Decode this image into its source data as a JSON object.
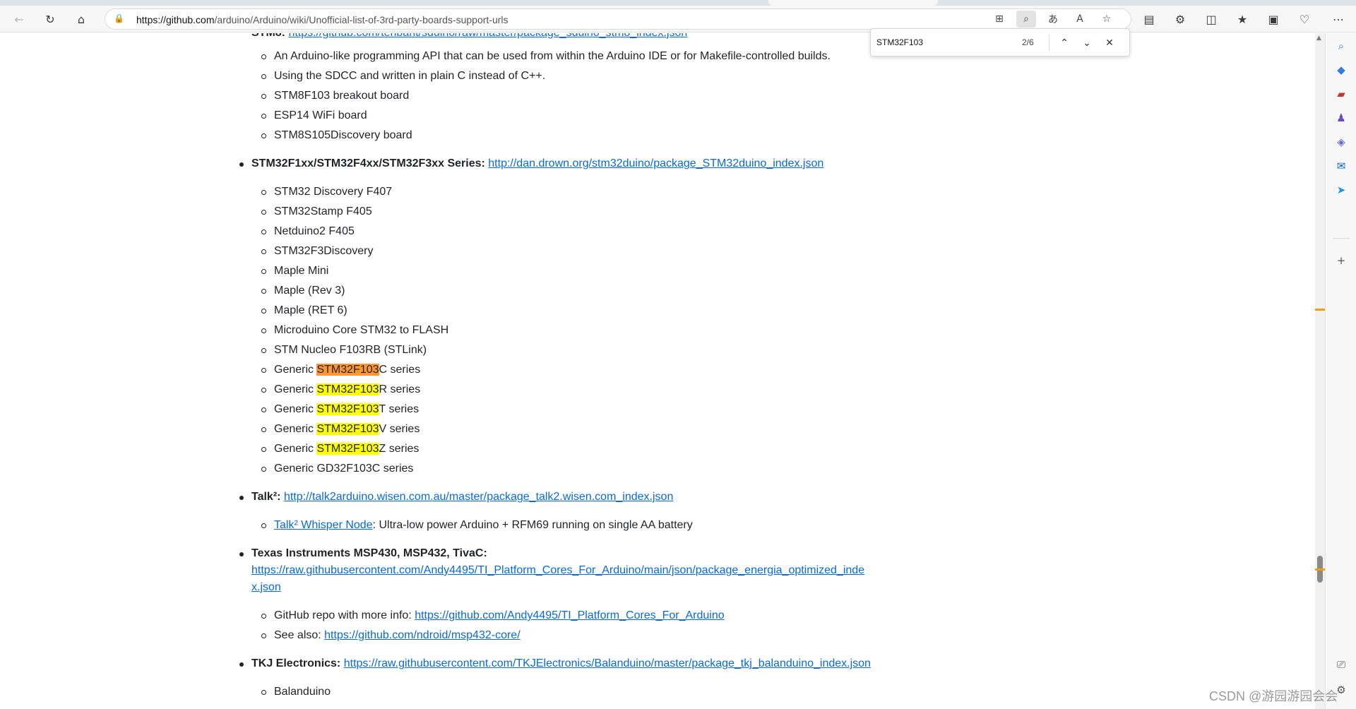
{
  "browser": {
    "url_host": "https://github.com",
    "url_path": "/arduino/Arduino/wiki/Unofficial-list-of-3rd-party-boards-support-urls",
    "toolbar": {
      "back_icon": "←",
      "refresh_icon": "↻",
      "home_icon": "⌂",
      "lock_icon": "🔒",
      "apps_icon": "⊞",
      "find_icon": "⌕",
      "translate_icon": "あ",
      "read_aloud_icon": "A",
      "favorite_icon": "☆",
      "tab_actions_icon": "▤",
      "extensions_icon": "⚙",
      "split_icon": "◫",
      "favorites_icon": "★",
      "collections_icon": "▣",
      "health_icon": "♡",
      "more_icon": "⋯"
    }
  },
  "findbar": {
    "query": "STM32F103",
    "count": "2/6",
    "prev_icon": "⌃",
    "next_icon": "⌄",
    "close_icon": "✕"
  },
  "content": {
    "partial_top_label": "STM8:",
    "partial_top_link": "https://github.com/tenbaht/sduino/raw/master/package_sduino_stm8_index.json",
    "stm8_items": [
      "An Arduino-like programming API that can be used from within the Arduino IDE or for Makefile-controlled builds.",
      "Using the SDCC and written in plain C instead of C++.",
      "STM8F103 breakout board",
      "ESP14 WiFi board",
      "STM8S105Discovery board"
    ],
    "stm32_label": "STM32F1xx/STM32F4xx/STM32F3xx Series:",
    "stm32_link": "http://dan.drown.org/stm32duino/package_STM32duino_index.json",
    "stm32_items": [
      "STM32 Discovery F407",
      "STM32Stamp F405",
      "Netduino2 F405",
      "STM32F3Discovery",
      "Maple Mini",
      "Maple (Rev 3)",
      "Maple (RET 6)",
      "Microduino Core STM32 to FLASH",
      "STM Nucleo F103RB (STLink)"
    ],
    "generic_prefix": "Generic ",
    "generic_match": "STM32F103",
    "generic_suffixes": [
      "C series",
      "R series",
      "T series",
      "V series",
      "Z series"
    ],
    "gd32_item": "Generic GD32F103C series",
    "talk_label": "Talk²:",
    "talk_link": "http://talk2arduino.wisen.com.au/master/package_talk2.wisen.com_index.json",
    "talk_item_link": "Talk² Whisper Node",
    "talk_item_text": ": Ultra-low power Arduino + RFM69 running on single AA battery",
    "ti_label": "Texas Instruments MSP430, MSP432, TivaC:",
    "ti_link_line1": "https://raw.githubusercontent.com/Andy4495/TI_Platform_Cores_For_Arduino/main/json/package_energia_optimized_inde",
    "ti_link_line2": "x.json",
    "ti_repo_label": "GitHub repo with more info: ",
    "ti_repo_link": "https://github.com/Andy4495/TI_Platform_Cores_For_Arduino",
    "ti_see_label": "See also: ",
    "ti_see_link": "https://github.com/ndroid/msp432-core/",
    "tkj_label": "TKJ Electronics:",
    "tkj_link": "https://raw.githubusercontent.com/TKJElectronics/Balanduino/master/package_tkj_balanduino_index.json",
    "tkj_item": "Balanduino"
  },
  "sidepanel": {
    "search_icon": "⌕",
    "shopping_icon": "◆",
    "tools_icon": "▰",
    "games_icon": "♟",
    "office_icon": "◈",
    "outlook_icon": "✉",
    "drop_icon": "➤",
    "add_icon": "+",
    "screenshot_icon": "⎚",
    "settings_icon": "⚙"
  },
  "watermark": "CSDN @游园游园会会"
}
